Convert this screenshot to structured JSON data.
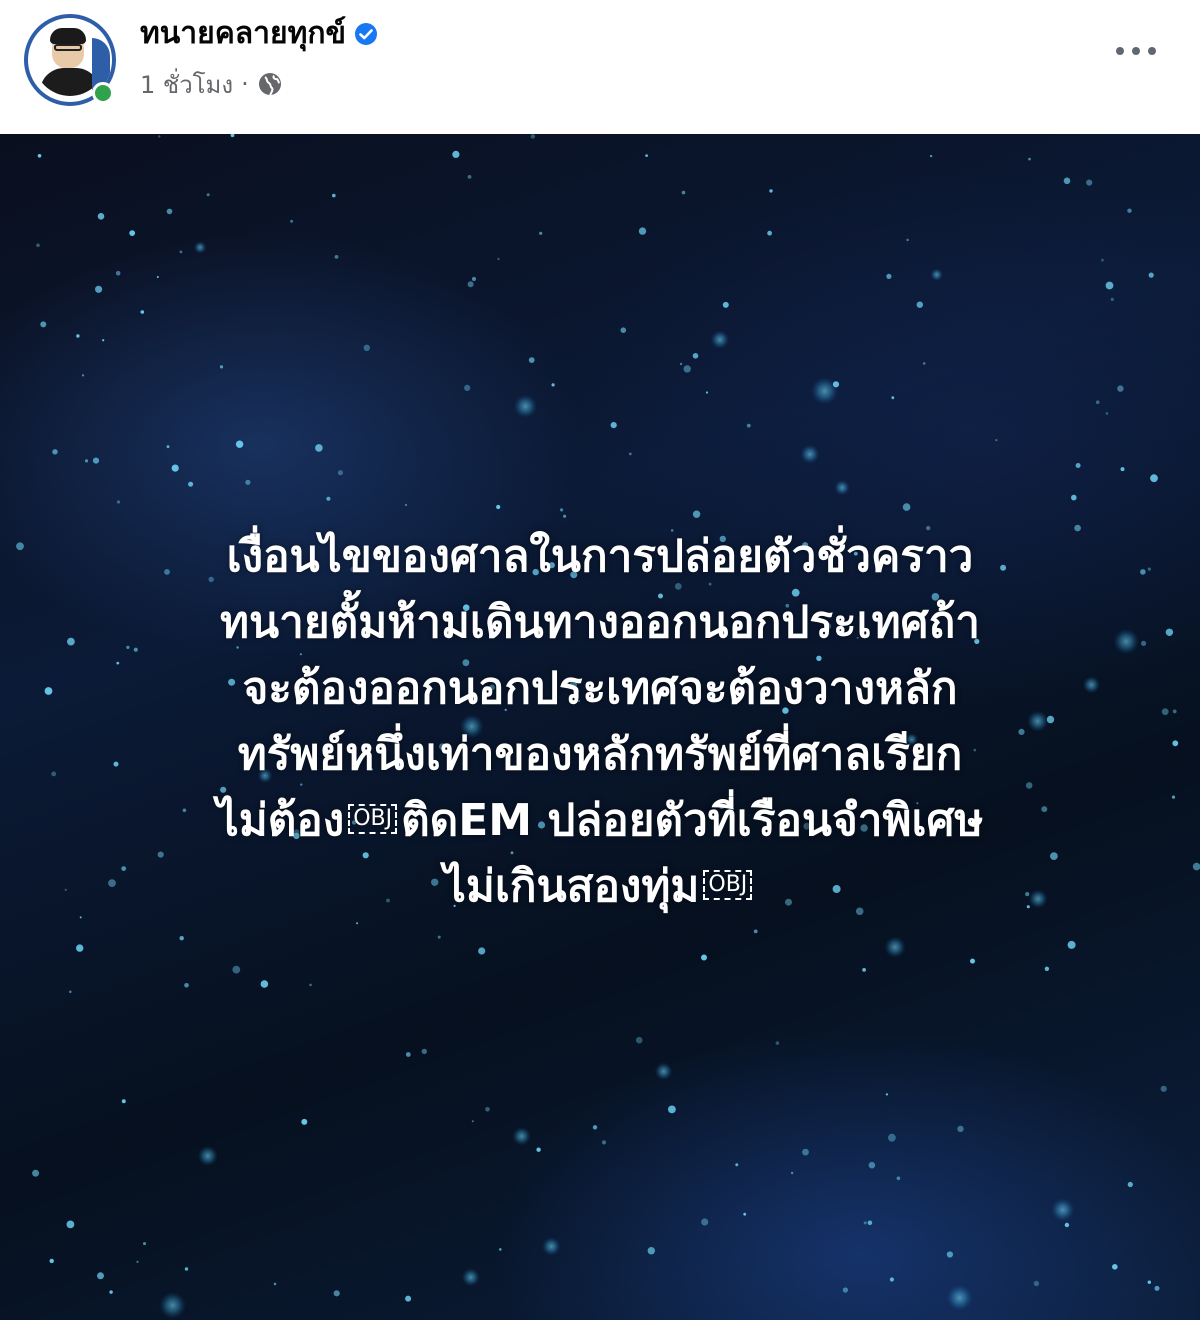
{
  "post": {
    "author": "ทนายคลายทุกข์",
    "time": "1 ชั่วโมง",
    "separator": "·",
    "verified_icon": "verified-badge-icon",
    "privacy_icon": "globe-icon",
    "more_icon": "more-options-icon"
  },
  "media": {
    "lines": [
      "เงื่อนไขของศาลในการปล่อยตัวชั่วคราว",
      "ทนายตั้มห้ามเดินทางออกนอกประเทศถ้า",
      "จะต้องออกนอกประเทศจะต้องวางหลัก",
      "ทรัพย์หนึ่งเท่าของหลักทรัพย์ที่ศาลเรียก"
    ],
    "line5_before": "ไม่ต้อง",
    "line5_after": "ติดEM ปล่อยตัวที่เรือนจำพิเศษ",
    "line6_text": "ไม่เกินสองทุ่ม",
    "obj_placeholder": "OBJ"
  },
  "colors": {
    "verified": "#1877f2",
    "online": "#31a24c",
    "meta_text": "#65676b",
    "text": "#ffffff"
  }
}
